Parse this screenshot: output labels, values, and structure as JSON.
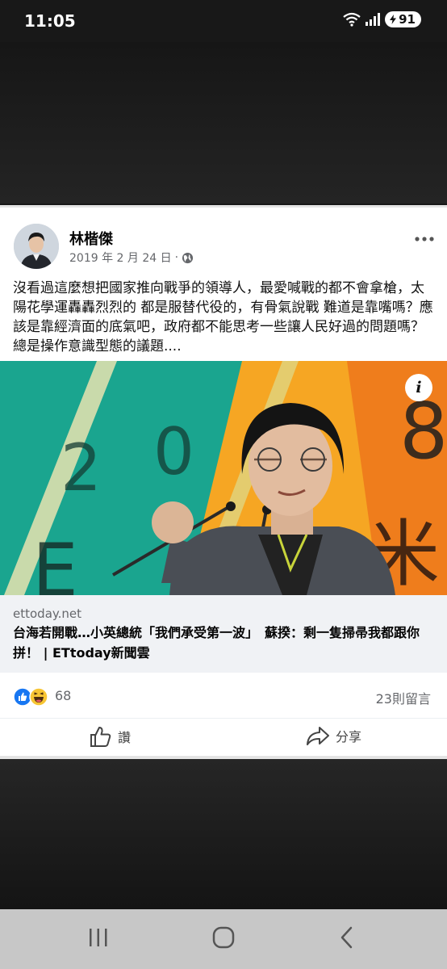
{
  "status_bar": {
    "time": "11:05",
    "battery": "91"
  },
  "post": {
    "author": "林楷傑",
    "date": "2019 年 2 月 24 日",
    "date_separator": "·",
    "text": "沒看過這麼想把國家推向戰爭的領導人，最愛喊戰的都不會拿槍，太陽花學運轟轟烈烈的 都是服替代役的，有骨氣說戰 難道是靠嘴嗎？應該是靠經濟面的底氣吧，政府都不能思考一些讓人民好過的問題嗎？總是操作意識型態的議題....",
    "link": {
      "domain": "ettoday.net",
      "title": "台海若開戰…小英總統「我們承受第一波」　蘇揆：剩一隻掃帚我都跟你拼！ | ETtoday新聞雲",
      "info_icon": "i",
      "image": {
        "backdrop_text": [
          "2",
          "0",
          "8",
          "E",
          "米"
        ]
      }
    },
    "reactions": {
      "count": "68",
      "comments": "23則留言"
    },
    "actions": {
      "like": "讚",
      "share": "分享"
    }
  },
  "colors": {
    "facebook_blue": "#1877f2",
    "teal": "#1aa58f",
    "orange": "#f6a623",
    "nav_bg": "#c7c7c7"
  },
  "icons": [
    "wifi-icon",
    "signal-icon",
    "battery-icon",
    "globe-icon",
    "more-icon",
    "info-icon",
    "like-reaction-icon",
    "haha-reaction-icon",
    "thumbs-up-icon",
    "share-icon",
    "recents-icon",
    "home-icon",
    "back-icon"
  ]
}
